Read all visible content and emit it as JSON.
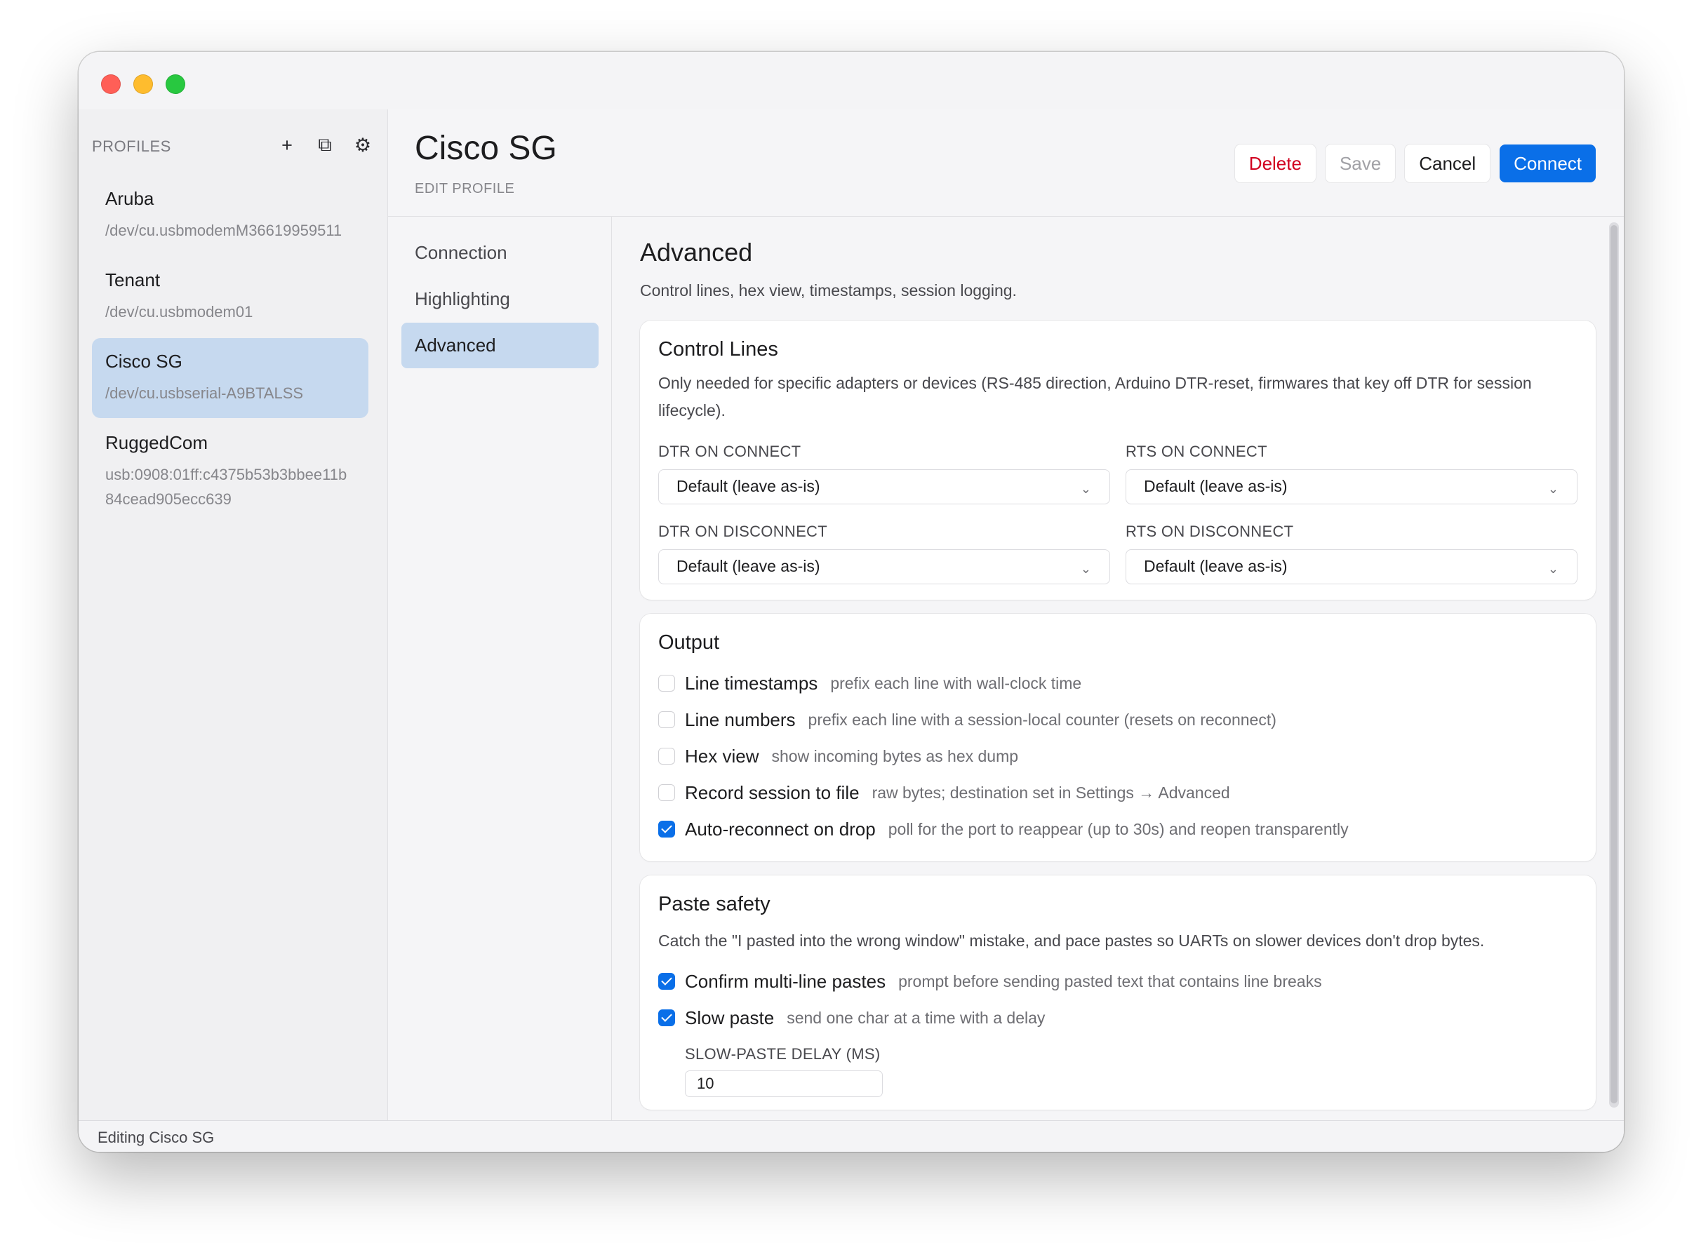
{
  "window": {
    "traffic_lights": {
      "close": "#ff5f57",
      "minimize": "#febc2e",
      "zoom": "#28c840"
    }
  },
  "sidebar": {
    "header": "PROFILES",
    "tools": [
      {
        "name": "add-icon",
        "glyph": "+"
      },
      {
        "name": "duplicate-icon",
        "glyph": "⧉"
      },
      {
        "name": "gear-icon",
        "glyph": "⚙"
      }
    ],
    "profiles": [
      {
        "name": "Aruba",
        "path": "/dev/cu.usbmodemM36619959511"
      },
      {
        "name": "Tenant",
        "path": "/dev/cu.usbmodem01"
      },
      {
        "name": "Cisco SG",
        "path": "/dev/cu.usbserial-A9BTALSS",
        "selected": true
      },
      {
        "name": "RuggedCom",
        "path": "usb:0908:01ff:c4375b53b3bbee11b84cead905ecc639"
      }
    ]
  },
  "header": {
    "title": "Cisco SG",
    "subtitle": "EDIT PROFILE",
    "buttons": {
      "delete": "Delete",
      "save": "Save",
      "cancel": "Cancel",
      "connect": "Connect"
    }
  },
  "nav": {
    "items": [
      {
        "label": "Connection"
      },
      {
        "label": "Highlighting"
      },
      {
        "label": "Advanced",
        "active": true
      }
    ]
  },
  "content": {
    "title": "Advanced",
    "description": "Control lines, hex view, timestamps, session logging.",
    "control_lines": {
      "title": "Control Lines",
      "description": "Only needed for specific adapters or devices (RS-485 direction, Arduino DTR-reset, firmwares that key off DTR for session lifecycle).",
      "fields": [
        {
          "label": "DTR ON CONNECT",
          "value": "Default (leave as-is)"
        },
        {
          "label": "RTS ON CONNECT",
          "value": "Default (leave as-is)"
        },
        {
          "label": "DTR ON DISCONNECT",
          "value": "Default (leave as-is)"
        },
        {
          "label": "RTS ON DISCONNECT",
          "value": "Default (leave as-is)"
        }
      ],
      "chevron": "⌄"
    },
    "output": {
      "title": "Output",
      "options": [
        {
          "label": "Line timestamps",
          "hint": "prefix each line with wall-clock time",
          "checked": false
        },
        {
          "label": "Line numbers",
          "hint": "prefix each line with a session-local counter (resets on reconnect)",
          "checked": false
        },
        {
          "label": "Hex view",
          "hint": "show incoming bytes as hex dump",
          "checked": false
        },
        {
          "label": "Record session to file",
          "hint": "raw bytes; destination set in Settings → Advanced",
          "checked": false
        },
        {
          "label": "Auto-reconnect on drop",
          "hint": "poll for the port to reappear (up to 30s) and reopen transparently",
          "checked": true
        }
      ]
    },
    "paste_safety": {
      "title": "Paste safety",
      "description": "Catch the \"I pasted into the wrong window\" mistake, and pace pastes so UARTs on slower devices don't drop bytes.",
      "options": [
        {
          "label": "Confirm multi-line pastes",
          "hint": "prompt before sending pasted text that contains line breaks",
          "checked": true
        },
        {
          "label": "Slow paste",
          "hint": "send one char at a time with a delay",
          "checked": true
        }
      ],
      "delay_label": "SLOW-PASTE DELAY (MS)",
      "delay_value": "10"
    }
  },
  "statusbar": {
    "text": "Editing Cisco SG"
  },
  "colors": {
    "accent": "#0a6fe8",
    "selection": "#c6d9ef",
    "danger": "#d1001f"
  }
}
